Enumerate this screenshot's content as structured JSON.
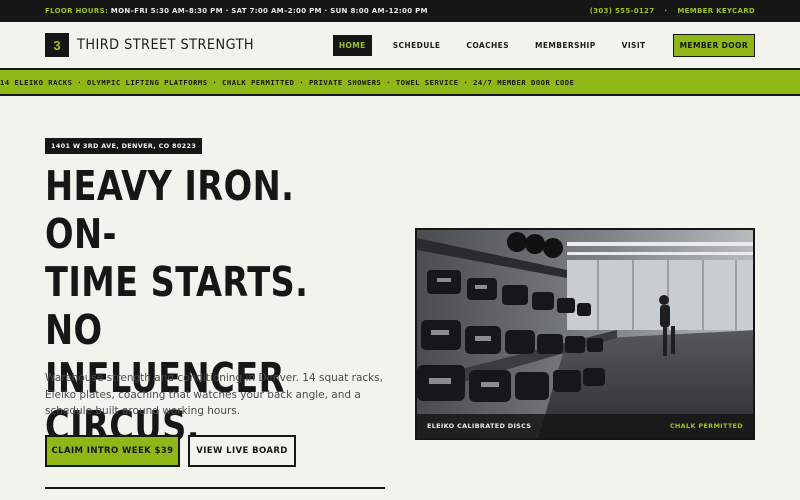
{
  "topbar": {
    "hours_label": "FLOOR HOURS:",
    "hours": "MON–FRI 5:30 AM–8:30 PM · SAT 7:00 AM–2:00 PM · SUN 8:00 AM–12:00 PM",
    "phone": "(303) 555-0127",
    "separator": "·",
    "keycard": "MEMBER KEYCARD"
  },
  "header": {
    "logo_mark": "3",
    "logo_text": "THIRD STREET STRENGTH",
    "nav": [
      "HOME",
      "SCHEDULE",
      "COACHES",
      "MEMBERSHIP",
      "VISIT"
    ],
    "door_button": "MEMBER DOOR"
  },
  "ticker": {
    "text": "14 ELEIKO RACKS · OLYMPIC LIFTING PLATFORMS · CHALK PERMITTED · PRIVATE SHOWERS · TOWEL SERVICE · 24/7 MEMBER DOOR CODE"
  },
  "hero": {
    "address": "1401 W 3RD AVE, DENVER, CO 80223",
    "headline_lines": [
      "HEAVY IRON. ON-",
      "TIME STARTS. NO",
      "INFLUENCER",
      "CIRCUS."
    ],
    "lede": "Warehouse strength and conditioning in Denver. 14 squat racks, Eleiko plates, coaching that watches your back angle, and a schedule built around working hours.",
    "primary_cta": "CLAIM INTRO WEEK $39",
    "secondary_cta": "VIEW LIVE BOARD"
  },
  "photo": {
    "caption_left": "ELEIKO CALIBRATED DISCS",
    "caption_right": "CHALK PERMITTED"
  },
  "colors": {
    "accent": "#8fb816",
    "dark": "#161616",
    "background": "#f3f3ee"
  }
}
